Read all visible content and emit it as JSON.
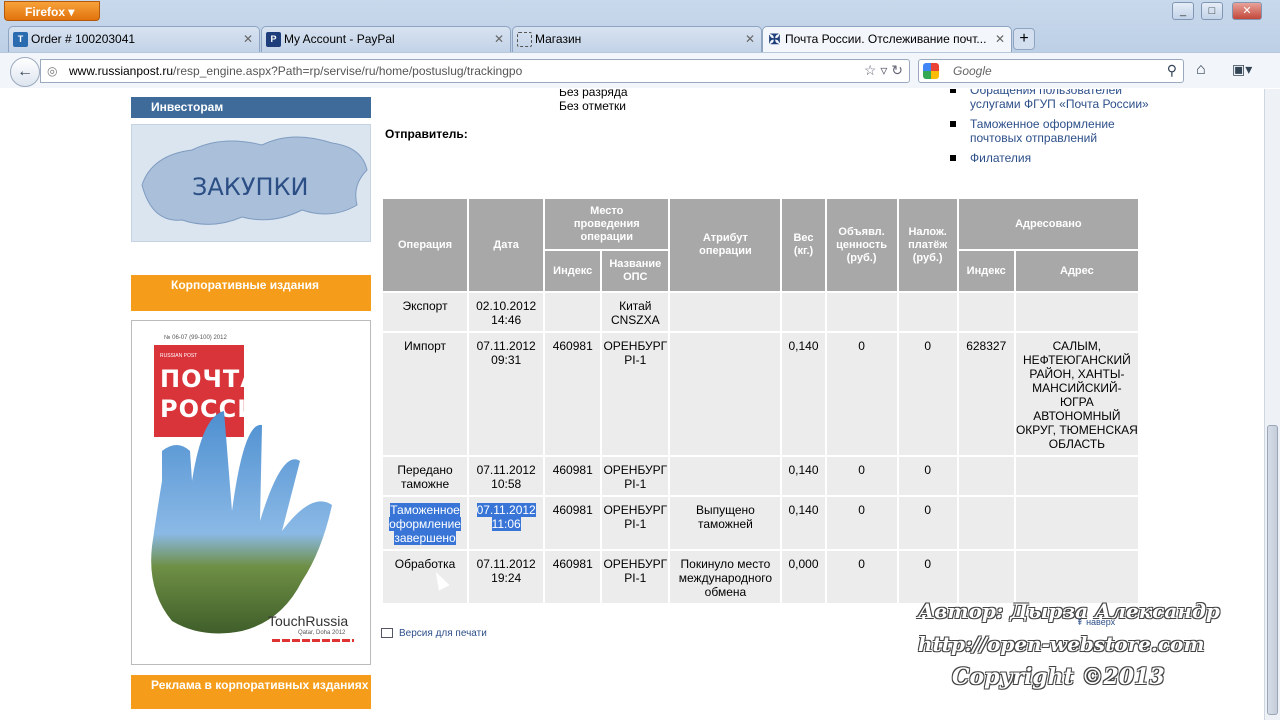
{
  "browser": {
    "menu_button": "Firefox",
    "tabs": [
      {
        "title": "Order # 100203041",
        "favicon": "T"
      },
      {
        "title": "My Account - PayPal",
        "favicon": "P"
      },
      {
        "title": "Магазин",
        "favicon": ""
      },
      {
        "title": "Почта России. Отслеживание почт...",
        "favicon": ""
      }
    ],
    "url_domain": "www.russianpost.ru",
    "url_path": "/resp_engine.aspx?Path=rp/servise/ru/home/postuslug/trackingpo",
    "search_placeholder": "Google"
  },
  "sidebar": {
    "investors": "Инвесторам",
    "zakupki": "ЗАКУПКИ",
    "corporate": "Корпоративные издания",
    "magazine": {
      "issue": "№ 06-07 (99-100) 2012",
      "brand_small": "RUSSIAN POST",
      "title_line1": "ПОЧТА",
      "title_line2": "РОССИИ",
      "touch": "TouchRussia",
      "place": "Qatar, Doha 2012"
    },
    "ads": "Реклама в корпоративных изданиях"
  },
  "main": {
    "meta_lines": [
      "Без разряда",
      "Без отметки"
    ],
    "sender_label": "Отправитель:",
    "right_links": [
      "Обращения пользователей услугами ФГУП «Почта России»",
      "Таможенное оформление почтовых отправлений",
      "Филателия"
    ],
    "table": {
      "headers": {
        "operation": "Операция",
        "date": "Дата",
        "place": "Место проведения операции",
        "place_index": "Индекс",
        "place_name": "Название ОПС",
        "attribute": "Атрибут операции",
        "weight": "Вес (кг.)",
        "declared": "Объявл. ценность (руб.)",
        "cod": "Налож. платёж (руб.)",
        "addressed": "Адресовано",
        "addr_index": "Индекс",
        "addr_address": "Адрес"
      },
      "rows": [
        {
          "op": "Экспорт",
          "date": "02.10.2012 14:46",
          "idx": "",
          "ops": "Китай CNSZXA",
          "attr": "",
          "weight": "",
          "declared": "",
          "cod": "",
          "aidx": "",
          "addr": ""
        },
        {
          "op": "Импорт",
          "date": "07.11.2012 09:31",
          "idx": "460981",
          "ops": "ОРЕНБУРГ PI-1",
          "attr": "",
          "weight": "0,140",
          "declared": "0",
          "cod": "0",
          "aidx": "628327",
          "addr": "САЛЫМ, НЕФТЕЮГАНСКИЙ РАЙОН, ХАНТЫ-МАНСИЙСКИЙ-ЮГРА АВТОНОМНЫЙ ОКРУГ, ТЮМЕНСКАЯ ОБЛАСТЬ"
        },
        {
          "op": "Передано таможне",
          "date": "07.11.2012 10:58",
          "idx": "460981",
          "ops": "ОРЕНБУРГ PI-1",
          "attr": "",
          "weight": "0,140",
          "declared": "0",
          "cod": "0",
          "aidx": "",
          "addr": ""
        },
        {
          "op": "Таможенное оформление завершено",
          "date": "07.11.2012 11:06",
          "idx": "460981",
          "ops": "ОРЕНБУРГ PI-1",
          "attr": "Выпущено таможней",
          "weight": "0,140",
          "declared": "0",
          "cod": "0",
          "aidx": "",
          "addr": ""
        },
        {
          "op": "Обработка",
          "date": "07.11.2012 19:24",
          "idx": "460981",
          "ops": "ОРЕНБУРГ PI-1",
          "attr": "Покинуло место международного обмена",
          "weight": "0,000",
          "declared": "0",
          "cod": "0",
          "aidx": "",
          "addr": ""
        }
      ]
    },
    "print_label": "Версия для печати",
    "up_label": "наверх"
  },
  "watermark": {
    "author": "Автор: Дырза Александр",
    "site": "http://open-webstore.com",
    "copyright": "Copyright ©2013"
  }
}
